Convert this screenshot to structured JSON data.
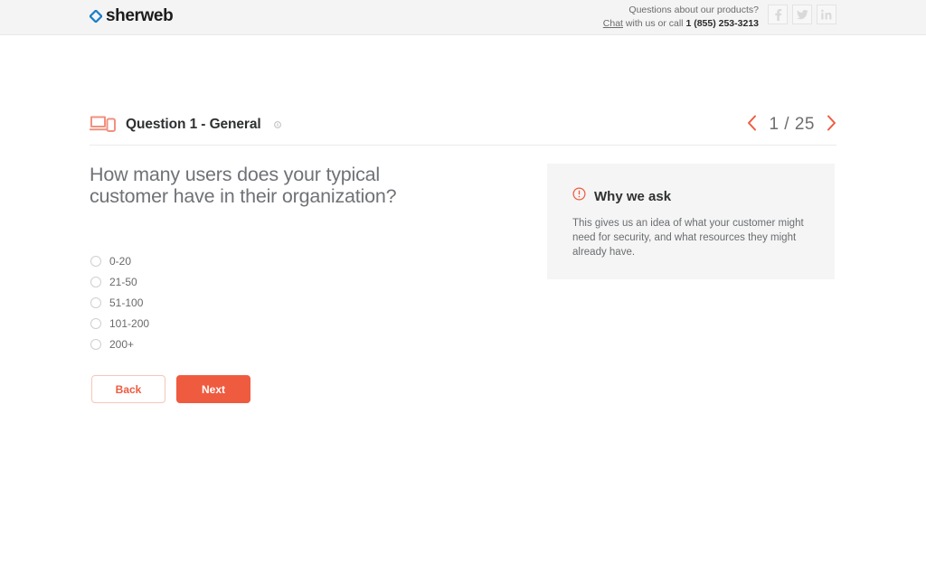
{
  "header": {
    "logo_text": "sherweb",
    "logo_icon": "diamond-logo-icon",
    "contact_line1": "Questions about our products?",
    "chat_link": "Chat",
    "contact_mid": " with us or call ",
    "phone": "1 (855) 253-3213",
    "socials": [
      {
        "name": "facebook-icon",
        "label": "f"
      },
      {
        "name": "twitter-icon",
        "label": "t"
      },
      {
        "name": "linkedin-icon",
        "label": "in"
      }
    ]
  },
  "question_header": {
    "icon": "devices-icon",
    "title": "Question 1 - General",
    "info_icon": "info-circle-icon",
    "pager": {
      "prev_icon": "chevron-left-icon",
      "next_icon": "chevron-right-icon",
      "count": "1 / 25",
      "current": 1,
      "total": 25
    }
  },
  "question": {
    "text": "How many users does your typical customer have in their organization?",
    "options": [
      {
        "label": "0-20",
        "selected": false
      },
      {
        "label": "21-50",
        "selected": false
      },
      {
        "label": "51-100",
        "selected": false
      },
      {
        "label": "101-200",
        "selected": false
      },
      {
        "label": "200+",
        "selected": false
      }
    ]
  },
  "actions": {
    "back_label": "Back",
    "next_label": "Next"
  },
  "why_panel": {
    "icon": "info-circle-icon",
    "title": "Why we ask",
    "body": "This gives us an idea of what your customer might need for security, and what resources they might already have."
  },
  "colors": {
    "accent": "#ef5b3f",
    "accent_light": "#f6a193",
    "logo_blue": "#1a7ec8",
    "header_bg": "#f4f4f4",
    "panel_bg": "#f5f5f5",
    "text_dark": "#2f3031",
    "text_muted": "#6f7276"
  }
}
